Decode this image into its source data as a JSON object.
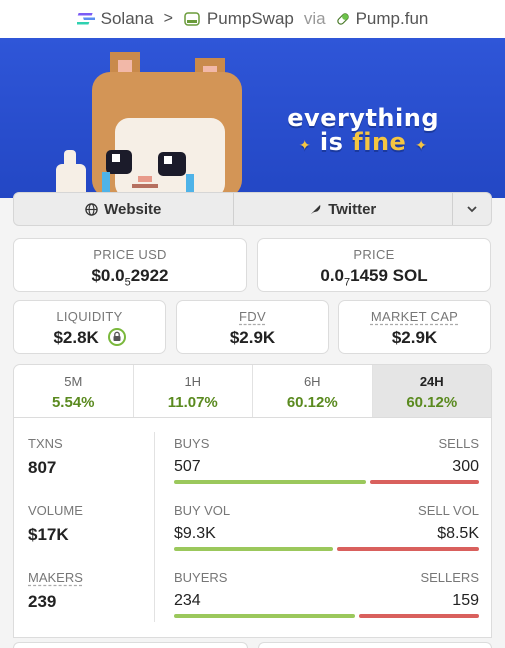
{
  "breadcrumb": {
    "chain": "Solana",
    "dex": "PumpSwap",
    "via": "via",
    "launchpad": "Pump.fun"
  },
  "banner": {
    "line1": "everything",
    "line2_a": "is",
    "line2_b": "fine"
  },
  "links": {
    "website": "Website",
    "twitter": "Twitter"
  },
  "price_usd": {
    "label": "PRICE USD",
    "value_prefix": "$0.0",
    "value_sub": "5",
    "value_rest": "2922"
  },
  "price_sol": {
    "label": "PRICE",
    "value_prefix": "0.0",
    "value_sub": "7",
    "value_rest": "1459 SOL"
  },
  "liquidity": {
    "label": "LIQUIDITY",
    "value": "$2.8K"
  },
  "fdv": {
    "label": "FDV",
    "value": "$2.9K"
  },
  "market_cap": {
    "label": "MARKET CAP",
    "value": "$2.9K"
  },
  "timeframes": [
    {
      "name": "5M",
      "value": "5.54%"
    },
    {
      "name": "1H",
      "value": "11.07%"
    },
    {
      "name": "6H",
      "value": "60.12%"
    },
    {
      "name": "24H",
      "value": "60.12%"
    }
  ],
  "stats": {
    "txns": {
      "label": "TXNS",
      "value": "807",
      "a_label": "BUYS",
      "a_value": "507",
      "b_label": "SELLS",
      "b_value": "300",
      "buy_ratio": 0.628
    },
    "volume": {
      "label": "VOLUME",
      "value": "$17K",
      "a_label": "BUY VOL",
      "a_value": "$9.3K",
      "b_label": "SELL VOL",
      "b_value": "$8.5K",
      "buy_ratio": 0.52
    },
    "makers": {
      "label": "MAKERS",
      "value": "239",
      "a_label": "BUYERS",
      "a_value": "234",
      "b_label": "SELLERS",
      "b_value": "159",
      "buy_ratio": 0.595
    }
  },
  "colors": {
    "banner": "#2f56d8",
    "positive": "#5a8a1f",
    "buy_bar": "#9bc85c",
    "sell_bar": "#d9605d"
  }
}
